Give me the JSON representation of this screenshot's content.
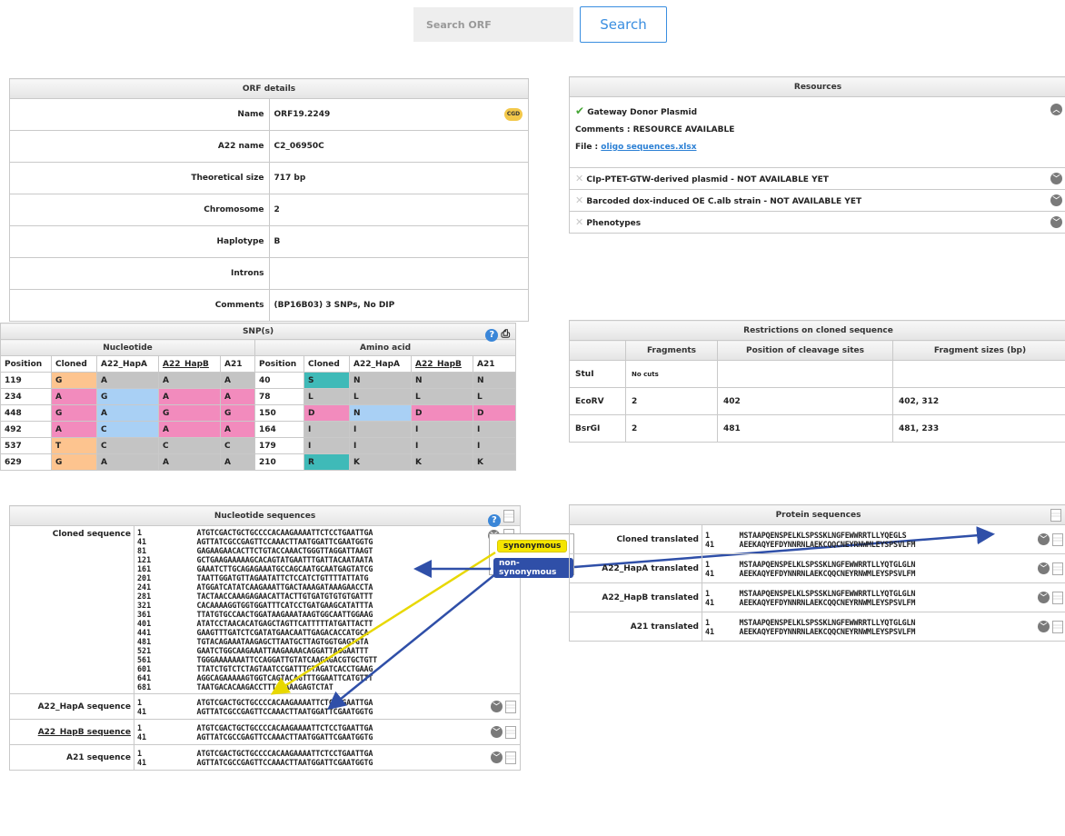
{
  "search": {
    "placeholder": "Search ORF",
    "button": "Search"
  },
  "orf": {
    "title": "ORF details",
    "cgd_logo": "CGD",
    "rows": [
      {
        "k": "Name",
        "v": "ORF19.2249"
      },
      {
        "k": "A22 name",
        "v": "C2_06950C"
      },
      {
        "k": "Theoretical size",
        "v": "717 bp"
      },
      {
        "k": "Chromosome",
        "v": "2"
      },
      {
        "k": "Haplotype",
        "v": "B"
      },
      {
        "k": "Introns",
        "v": ""
      },
      {
        "k": "Comments",
        "v": "(BP16B03) 3 SNPs, No DIP"
      }
    ]
  },
  "resources": {
    "title": "Resources",
    "first": {
      "name": "Gateway Donor Plasmid",
      "comments": "Comments : RESOURCE AVAILABLE",
      "file_label": "File : ",
      "file_link": "oligo sequences.xlsx"
    },
    "others": [
      "CIp-PTET-GTW-derived plasmid - NOT AVAILABLE YET",
      "Barcoded dox-induced OE C.alb strain - NOT AVAILABLE YET",
      "Phenotypes"
    ]
  },
  "snp": {
    "title": "SNP(s)",
    "group_nuc": "Nucleotide",
    "group_aa": "Amino acid",
    "headers": [
      "Position",
      "Cloned",
      "A22_HapA",
      "A22_HapB",
      "A21",
      "Position",
      "Cloned",
      "A22_HapA",
      "A22_HapB",
      "A21"
    ],
    "rows": [
      [
        "119",
        "G",
        "A",
        "A",
        "A",
        "40",
        "S",
        "N",
        "N",
        "N"
      ],
      [
        "234",
        "A",
        "G",
        "A",
        "A",
        "78",
        "L",
        "L",
        "L",
        "L"
      ],
      [
        "448",
        "G",
        "A",
        "G",
        "G",
        "150",
        "D",
        "N",
        "D",
        "D"
      ],
      [
        "492",
        "A",
        "C",
        "A",
        "A",
        "164",
        "I",
        "I",
        "I",
        "I"
      ],
      [
        "537",
        "T",
        "C",
        "C",
        "C",
        "179",
        "I",
        "I",
        "I",
        "I"
      ],
      [
        "629",
        "G",
        "A",
        "A",
        "A",
        "210",
        "R",
        "K",
        "K",
        "K"
      ]
    ],
    "colors": {
      "orange": "#fdc48f",
      "blue": "#a9d0f5",
      "pink": "#f28bbd",
      "gray": "#c4c4c4",
      "teal": "#3fbab8"
    }
  },
  "restrictions": {
    "title": "Restrictions on cloned sequence",
    "headers": [
      "",
      "Fragments",
      "Position of cleavage sites",
      "Fragment sizes (bp)"
    ],
    "rows": [
      [
        "StuI",
        "No cuts",
        "",
        ""
      ],
      [
        "EcoRV",
        "2",
        "402",
        "402, 312"
      ],
      [
        "BsrGI",
        "2",
        "481",
        "481, 233"
      ]
    ]
  },
  "nucleotide": {
    "title": "Nucleotide sequences",
    "cloned_label": "Cloned sequence",
    "cloned_nums": "1\n41\n81\n121\n161\n201\n241\n281\n321\n361\n401\n441\n481\n521\n561\n601\n641\n681",
    "cloned_seq": "ATGTCGACTGCTGCCCCACAAGAAAATTCTCCTGAATTGA\nAGTTATCGCCGAGTTCCAAACTTAATGGATTCGAATGGTG\nGAGAAGAACACTTCTGTACCAAACTGGGTTAGGATTAAGT\nGCTGAAGAAAAAGCACAGTATGAATTTGATTACAATAATA\nGAAATCTTGCAGAGAAATGCCAGCAATGCAATGAGTATCG\nTAATTGGATGTTAGAATATTCTCCATCTGTTTTATTATG\nATGGATCATATCAAGAAATTGACTAAAGATAAAGAACCTA\nTACTAACCAAAGAGAACATTACTTGTGATGTGTGTGATTT\nCACAAAAGGTGGTGGATTTCATCCTGATGAAGCATATTTA\nTTATGTGCCAACTGGATAAGAAATAAGTGGCAATTGGAAG\nATATCCTAACACATGAGCTAGTTCATTTTTATGATTACTT\nGAAGTTTGATCTCGATATGAACAATTGAGACACCATGCA\nTGTACAGAAATAAGAGCTTAATGCTTAGTGGTGAGTGTA\nGAATCTGGCAAGAAATTAAGAAAACAGGATTAGGAATTT\nTGGGAAAAAAATTCCAGGATTGTATCAAGAGACGTGCTGTT\nTTATCTGTCTCTAGTAATCCGATTTGTAGATCACCTGAAG\nAGGCAGAAAAAGTGGTCAGTACAGTTTGGAATTCATGTTT\nTAATGACACAAGACCTTTCGAAAGAGTCTAT",
    "seqs": [
      {
        "label": "A22_HapA sequence",
        "nums": "1\n41",
        "seq": "ATGTCGACTGCTGCCCCACAAGAAAATTCTCCTGAATTGA\nAGTTATCGCCGAGTTCCAAACTTAATGGATTCGAATGGTG"
      },
      {
        "label": "A22_HapB sequence",
        "nums": "1\n41",
        "seq": "ATGTCGACTGCTGCCCCACAAGAAAATTCTCCTGAATTGA\nAGTTATCGCCGAGTTCCAAACTTAATGGATTCGAATGGTG"
      },
      {
        "label": "A21 sequence",
        "nums": "1\n41",
        "seq": "ATGTCGACTGCTGCCCCACAAGAAAATTCTCCTGAATTGA\nAGTTATCGCCGAGTTCCAAACTTAATGGATTCGAATGGTG"
      }
    ],
    "legend_syn": "synonymous",
    "legend_nonsyn": "non-synonymous"
  },
  "protein": {
    "title": "Protein sequences",
    "rows": [
      {
        "label": "Cloned translated",
        "nums": "1\n41",
        "seq": "MSTAAPQENSPELKLSPSSKLNGFEWWRRTLLYQEGLS\nAEEKAQYEFDYNNRNLAEKCQQCNEYRNWMLEYSPSVLFM"
      },
      {
        "label": "A22_HapA translated",
        "nums": "1\n41",
        "seq": "MSTAAPQENSPELKLSPSSKLNGFEWWRRTLLYQTGLGLN\nAEEKAQYEFDYNNRNLAEKCQQCNEYRNWMLEYSPSVLFM"
      },
      {
        "label": "A22_HapB translated",
        "nums": "1\n41",
        "seq": "MSTAAPQENSPELKLSPSSKLNGFEWWRRTLLYQTGLGLN\nAEEKAQYEFDYNNRNLAEKCQQCNEYRNWMLEYSPSVLFM"
      },
      {
        "label": "A21 translated",
        "nums": "1\n41",
        "seq": "MSTAAPQENSPELKLSPSSKLNGFEWWRRTLLYQTGLGLN\nAEEKAQYEFDYNNRNLAEKCQQCNEYRNWMLEYSPSVLFM"
      }
    ]
  },
  "icons": {
    "help": "help-icon",
    "print": "print-icon",
    "doc": "document-icon",
    "check": "check-icon",
    "x": "x-icon",
    "chevron": "chevron-icon"
  }
}
